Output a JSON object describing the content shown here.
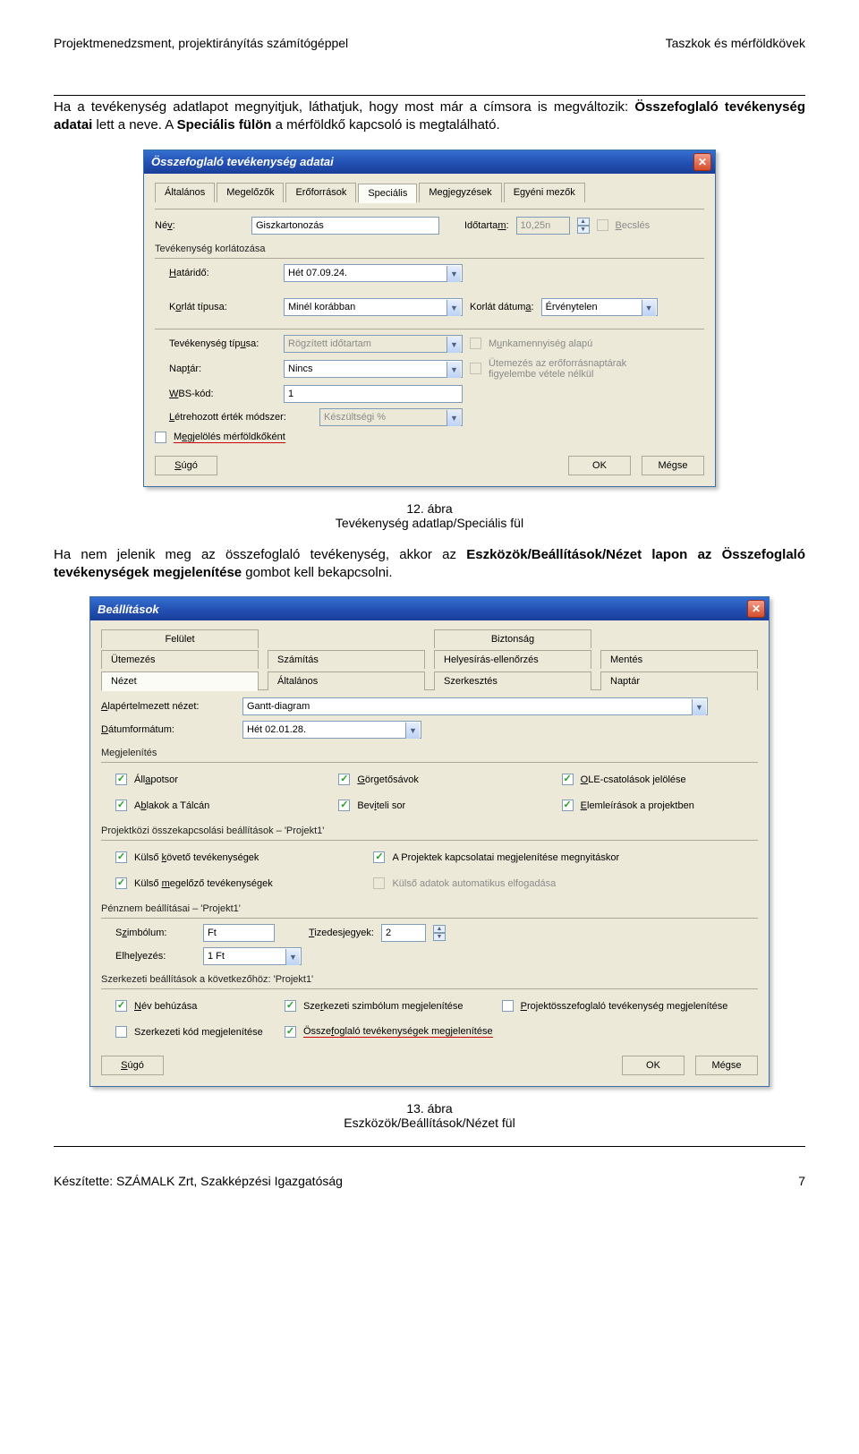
{
  "header": {
    "left": "Projektmenedzsment, projektirányítás számítógéppel",
    "right": "Taszkok és mérföldkövek"
  },
  "para1_prefix": "Ha a tevékenység adatlapot megnyitjuk, láthatjuk, hogy most már a címsora is megváltozik: ",
  "para1_bold1": "Összefoglaló tevékenység adatai",
  "para1_mid": " lett a neve. A ",
  "para1_bold2": "Speciális fülön",
  "para1_suffix": " a mérföldkő kapcsoló is megtalálható.",
  "dlg1": {
    "title": "Összefoglaló tevékenység adatai",
    "tabs": [
      "Általános",
      "Megelőzők",
      "Erőforrások",
      "Speciális",
      "Megjegyzések",
      "Egyéni mezők"
    ],
    "nev_lbl": "Név:",
    "nev_val": "Giszkartonozás",
    "idotartam_lbl": "Időtartam:",
    "idotartam_val": "10,25n",
    "becsles_lbl": "Becslés",
    "group1": "Tevékenység korlátozása",
    "hatarido_lbl": "Határidő:",
    "hatarido_val": "Hét 07.09.24.",
    "korlat_tipus_lbl": "Korlát típusa:",
    "korlat_tipus_val": "Minél korábban",
    "korlat_datum_lbl": "Korlát dátuma:",
    "korlat_datum_val": "Érvénytelen",
    "tev_tipus_lbl": "Tevékenység típusa:",
    "tev_tipus_val": "Rögzített időtartam",
    "munka_lbl": "Munkamennyiség alapú",
    "naptar_lbl": "Naptár:",
    "naptar_val": "Nincs",
    "utemezes_lbl": "Ütemezés az erőforrásnaptárak figyelembe vétele nélkül",
    "wbs_lbl": "WBS-kód:",
    "wbs_val": "1",
    "letre_lbl": "Létrehozott érték módszer:",
    "letre_val": "Készültségi %",
    "megjel_lbl": "Megjelölés mérföldkőként",
    "sugo": "Súgó",
    "ok": "OK",
    "megse": "Mégse"
  },
  "caption1_num": "12. ábra",
  "caption1_txt": "Tevékenység adatlap/Speciális fül",
  "para2_prefix": "Ha nem jelenik meg az összefoglaló tevékenység, akkor az ",
  "para2_bold": "Eszközök/Beállítások/Nézet lapon az Összefoglaló tevékenységek megjelenítése",
  "para2_suffix": " gombot kell bekapcsolni.",
  "dlg2": {
    "title": "Beállítások",
    "tabs_row1": [
      "Felület",
      "Biztonság"
    ],
    "tabs_row2": [
      "Ütemezés",
      "Számítás",
      "Helyesírás-ellenőrzés",
      "Mentés"
    ],
    "tabs_row3": [
      "Nézet",
      "Általános",
      "Szerkesztés",
      "Naptár"
    ],
    "alap_lbl": "Alapértelmezett nézet:",
    "alap_val": "Gantt-diagram",
    "datum_lbl": "Dátumformátum:",
    "datum_val": "Hét 02.01.28.",
    "megj_group": "Megjelenítés",
    "checks": {
      "allapot": "Állapotsor",
      "gorget": "Görgetősávok",
      "ole": "OLE-csatolások jelölése",
      "ablak": "Ablakok a Tálcán",
      "bevitel": "Beviteli sor",
      "elemle": "Elemleírások a projektben"
    },
    "projektkoz": "Projektközi összekapcsolási beállítások – 'Projekt1'",
    "kulso_koveto": "Külső követő tevékenységek",
    "proj_kapcs": "A Projektek kapcsolatai megjelenítése megnyitáskor",
    "kulso_megel": "Külső megelőző tevékenységek",
    "kulso_adatok": "Külső adatok automatikus elfogadása",
    "penznem": "Pénznem beállításai – 'Projekt1'",
    "szimb_lbl": "Szimbólum:",
    "szimb_val": "Ft",
    "tized_lbl": "Tizedesjegyek:",
    "tized_val": "2",
    "elh_lbl": "Elhelyezés:",
    "elh_val": "1 Ft",
    "szerk_be": "Szerkezeti beállítások a következőhöz: 'Projekt1'",
    "nev_beh": "Név behúzása",
    "szerk_szimb": "Szerkezeti szimbólum megjelenítése",
    "proj_ossz": "Projektösszefoglaló tevékenység megjelenítése",
    "szerk_kod": "Szerkezeti kód megjelenítése",
    "ossz_tev": "Összefoglaló tevékenységek megjelenítése",
    "sugo": "Súgó",
    "ok": "OK",
    "megse": "Mégse"
  },
  "caption2_num": "13. ábra",
  "caption2_txt": "Eszközök/Beállítások/Nézet fül",
  "footer": {
    "left": "Készítette: SZÁMALK Zrt, Szakképzési Igazgatóság",
    "right": "7"
  }
}
